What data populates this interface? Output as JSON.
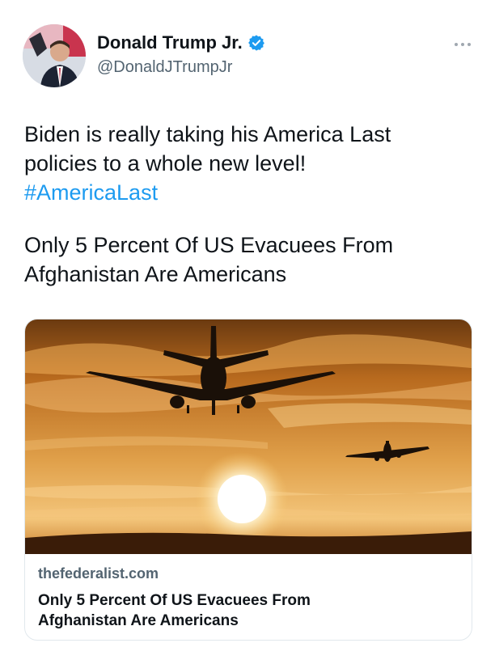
{
  "author": {
    "display_name": "Donald Trump Jr.",
    "handle": "@DonaldJTrumpJr",
    "verified": true,
    "avatar_icon": "profile-photo"
  },
  "tweet": {
    "text_lines": [
      "Biden is really taking his America Last",
      "policies to a whole new level!"
    ],
    "hashtag": "#AmericaLast",
    "headline_lines": [
      "Only 5 Percent Of US Evacuees From",
      "Afghanistan Are Americans"
    ]
  },
  "card": {
    "domain": "thefederalist.com",
    "title_lines": [
      "Only 5 Percent Of US Evacuees From",
      "Afghanistan Are Americans"
    ],
    "image_icon": "airplanes-sunset-photo"
  },
  "colors": {
    "link": "#1d9bf0",
    "verified": "#1d9bf0",
    "text": "#0f1419",
    "secondary": "#536471"
  }
}
